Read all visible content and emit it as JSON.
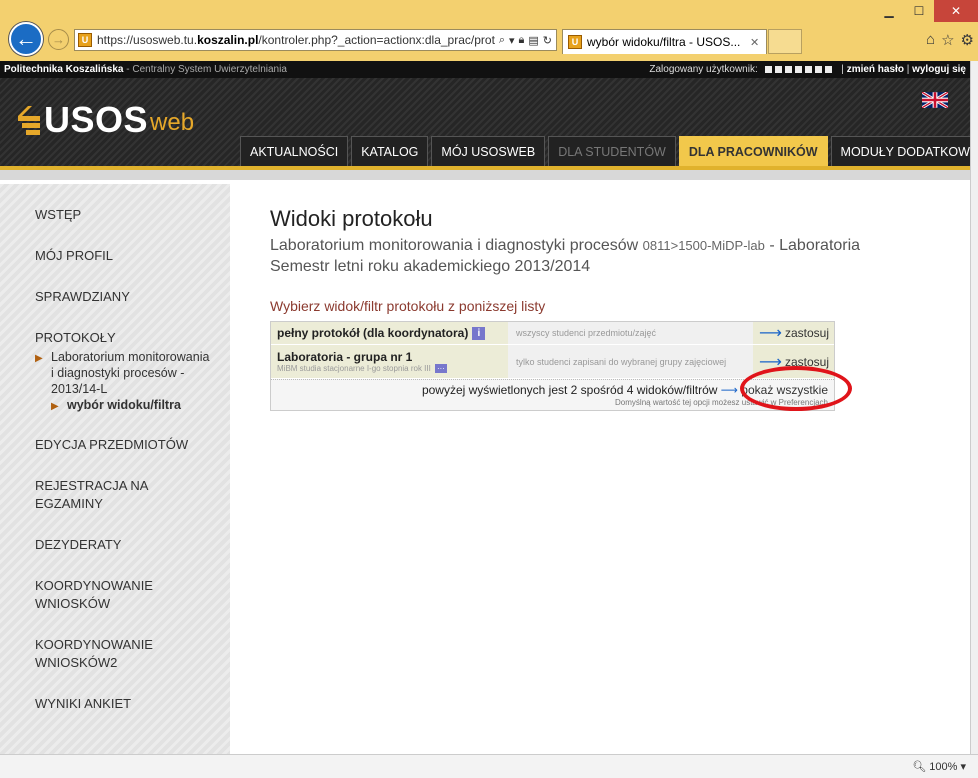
{
  "browser": {
    "url_prefix": "https://usosweb.tu.",
    "url_domain": "koszalin.pl",
    "url_rest": "/kontroler.php?_action=actionx:dla_prac/protokol",
    "tab_title": "wybór widoku/filtra - USOS...",
    "favicon_letter": "U",
    "zoom": "100%",
    "icons": [
      "back-arrow-icon",
      "forward-arrow-icon",
      "search-icon",
      "lock-icon",
      "refresh-icon",
      "home-icon",
      "star-icon",
      "gear-icon"
    ]
  },
  "top_strip": {
    "institution": "Politechnika Koszalińska",
    "system": "- Centralny System Uwierzytelniania",
    "logged_label": "Zalogowany użytkownik:",
    "change_password": "zmień hasło",
    "logout": "wyloguj się"
  },
  "logo": {
    "main": "USOS",
    "suffix": "web"
  },
  "nav": [
    {
      "label": "AKTUALNOŚCI",
      "state": "normal"
    },
    {
      "label": "KATALOG",
      "state": "normal"
    },
    {
      "label": "MÓJ USOSWEB",
      "state": "normal"
    },
    {
      "label": "DLA STUDENTÓW",
      "state": "disabled"
    },
    {
      "label": "DLA PRACOWNIKÓW",
      "state": "active"
    },
    {
      "label": "MODUŁY DODATKOWE",
      "state": "normal"
    }
  ],
  "sidebar": {
    "items": [
      {
        "label": "WSTĘP"
      },
      {
        "label": "MÓJ PROFIL"
      },
      {
        "label": "SPRAWDZIANY"
      },
      {
        "label": "PROTOKOŁY"
      },
      {
        "label": "EDYCJA PRZEDMIOTÓW"
      },
      {
        "label": "REJESTRACJA NA EGZAMINY"
      },
      {
        "label": "DEZYDERATY"
      },
      {
        "label": "KOORDYNOWANIE WNIOSKÓW"
      },
      {
        "label": "KOORDYNOWANIE WNIOSKÓW2"
      },
      {
        "label": "WYNIKI ANKIET"
      }
    ],
    "sub1": "Laboratorium monitorowania i diagnostyki procesów - 2013/14-L",
    "sub2": "wybór widoku/filtra"
  },
  "content": {
    "title": "Widoki protokołu",
    "course_name": "Laboratorium monitorowania i diagnostyki procesów",
    "course_code": "0811>1500-MiDP-lab",
    "course_type": "- Laboratoria",
    "semester": "Semestr letni roku akademickiego 2013/2014",
    "instruction": "Wybierz widok/filtr protokołu z poniższej listy",
    "rows": [
      {
        "name": "pełny protokół (dla koordynatora)",
        "sub": "",
        "desc": "wszyscy studenci przedmiotu/zajęć",
        "action": "zastosuj"
      },
      {
        "name": "Laboratoria - grupa nr 1",
        "sub": "MiBM studia stacjonarne I-go stopnia rok III",
        "desc": "tylko studenci zapisani do wybranej grupy zajęciowej",
        "action": "zastosuj"
      }
    ],
    "footer_text": "powyżej wyświetlonych jest 2 spośród 4 widoków/filtrów",
    "footer_link": "pokaż wszystkie",
    "footer_note": "Domyślną wartość tej opcji możesz ustawić w Preferencjach"
  },
  "colors": {
    "accent": "#f2c84b",
    "link_arrow": "#1a64c8",
    "highlight": "#e0141a"
  }
}
